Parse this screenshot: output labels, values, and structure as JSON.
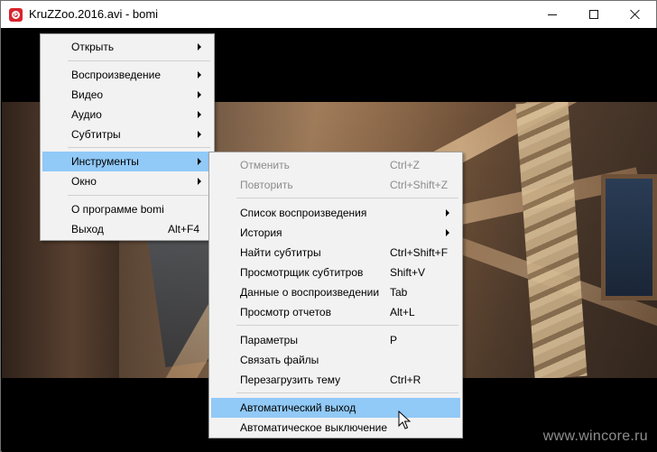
{
  "window": {
    "title": "KruZZoo.2016.avi - bomi",
    "controls": [
      "minimize-icon",
      "maximize-icon",
      "close-icon"
    ]
  },
  "watermark": "www.wincore.ru",
  "main_menu": {
    "items": [
      {
        "label": "Открыть",
        "submenu": true
      },
      {
        "label": "Воспроизведение",
        "submenu": true
      },
      {
        "label": "Видео",
        "submenu": true
      },
      {
        "label": "Аудио",
        "submenu": true
      },
      {
        "label": "Субтитры",
        "submenu": true
      },
      {
        "label": "Инструменты",
        "submenu": true,
        "highlighted": true
      },
      {
        "label": "Окно",
        "submenu": true
      },
      {
        "label": "О программе bomi"
      },
      {
        "label": "Выход",
        "shortcut": "Alt+F4"
      }
    ]
  },
  "tools_menu": {
    "items": [
      {
        "label": "Отменить",
        "shortcut": "Ctrl+Z",
        "disabled": true
      },
      {
        "label": "Повторить",
        "shortcut": "Ctrl+Shift+Z",
        "disabled": true
      },
      {
        "label": "Список воспроизведения",
        "submenu": true
      },
      {
        "label": "История",
        "submenu": true
      },
      {
        "label": "Найти субтитры",
        "shortcut": "Ctrl+Shift+F"
      },
      {
        "label": "Просмотрщик субтитров",
        "shortcut": "Shift+V"
      },
      {
        "label": "Данные о воспроизведении",
        "shortcut": "Tab"
      },
      {
        "label": "Просмотр отчетов",
        "shortcut": "Alt+L"
      },
      {
        "label": "Параметры",
        "shortcut": "P"
      },
      {
        "label": "Связать файлы"
      },
      {
        "label": "Перезагрузить тему",
        "shortcut": "Ctrl+R"
      },
      {
        "label": "Автоматический выход",
        "highlighted": true
      },
      {
        "label": "Автоматическое выключение"
      }
    ]
  },
  "colors": {
    "highlight": "#91c9f7",
    "menu_bg": "#f2f2f2",
    "disabled_text": "#8c8c8c",
    "app_icon": "#d9242e"
  }
}
